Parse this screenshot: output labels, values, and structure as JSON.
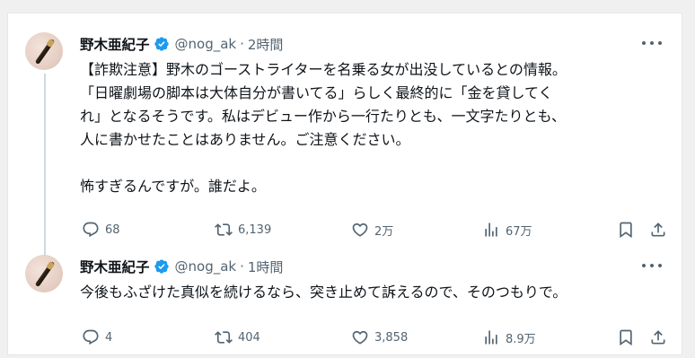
{
  "colors": {
    "verified": "#1d9bf0",
    "text": "#0f1419",
    "muted": "#536471",
    "thread_line": "#cfd9de"
  },
  "tweets": [
    {
      "name": "野木亜紀子",
      "handle": "@nog_ak",
      "separator": "·",
      "time": "2時間",
      "lines": [
        "【詐欺注意】野木のゴーストライターを名乗る女が出没しているとの情報。",
        "「日曜劇場の脚本は大体自分が書いてる」らしく最終的に「金を貸してく",
        "れ」となるそうです。私はデビュー作から一行たりとも、一文字たりとも、",
        "人に書かせたことはありません。ご注意ください。",
        "",
        "怖すぎるんですが。誰だよ。"
      ],
      "stats": {
        "replies": "68",
        "retweets": "6,139",
        "likes": "2万",
        "views": "67万"
      }
    },
    {
      "name": "野木亜紀子",
      "handle": "@nog_ak",
      "separator": "·",
      "time": "1時間",
      "lines": [
        "今後もふざけた真似を続けるなら、突き止めて訴えるので、そのつもりで。"
      ],
      "stats": {
        "replies": "4",
        "retweets": "404",
        "likes": "3,858",
        "views": "8.9万"
      }
    }
  ]
}
